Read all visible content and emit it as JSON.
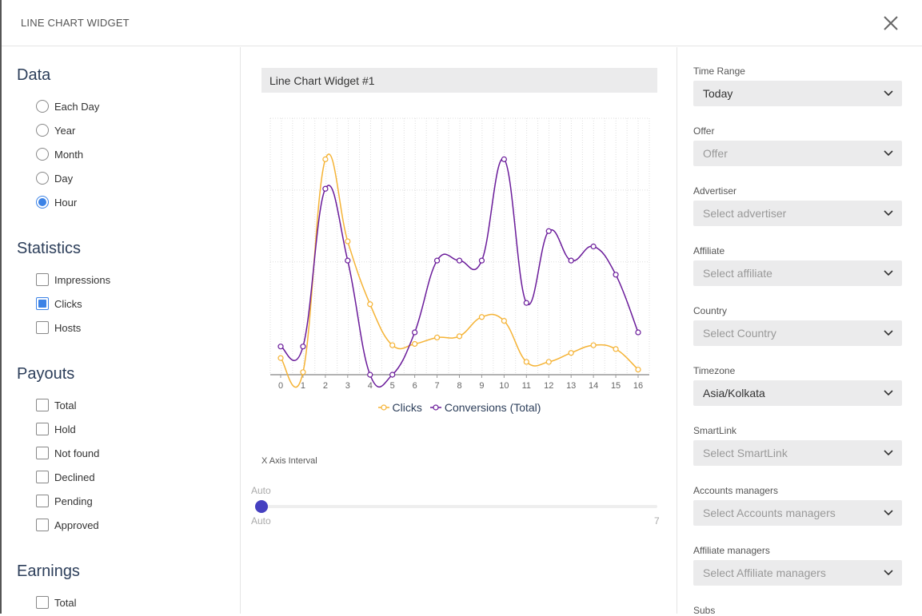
{
  "header": {
    "title": "LINE CHART WIDGET"
  },
  "left": {
    "data_section": {
      "title": "Data",
      "options": [
        {
          "label": "Each Day",
          "selected": false
        },
        {
          "label": "Year",
          "selected": false
        },
        {
          "label": "Month",
          "selected": false
        },
        {
          "label": "Day",
          "selected": false
        },
        {
          "label": "Hour",
          "selected": true
        }
      ]
    },
    "statistics_section": {
      "title": "Statistics",
      "options": [
        {
          "label": "Impressions",
          "checked": false
        },
        {
          "label": "Clicks",
          "checked": true
        },
        {
          "label": "Hosts",
          "checked": false
        }
      ]
    },
    "payouts_section": {
      "title": "Payouts",
      "options": [
        {
          "label": "Total",
          "checked": false
        },
        {
          "label": "Hold",
          "checked": false
        },
        {
          "label": "Not found",
          "checked": false
        },
        {
          "label": "Declined",
          "checked": false
        },
        {
          "label": "Pending",
          "checked": false
        },
        {
          "label": "Approved",
          "checked": false
        }
      ]
    },
    "earnings_section": {
      "title": "Earnings",
      "options": [
        {
          "label": "Total",
          "checked": false
        }
      ]
    }
  },
  "center": {
    "widget_name": "Line Chart Widget #1",
    "slider": {
      "label": "X Axis Interval",
      "current_label": "Auto",
      "min_label": "Auto",
      "max_label": "7",
      "value_fraction": 0
    }
  },
  "right": {
    "fields": [
      {
        "label": "Time Range",
        "value": "Today",
        "filled": true
      },
      {
        "label": "Offer",
        "value": "Offer",
        "filled": false
      },
      {
        "label": "Advertiser",
        "value": "Select advertiser",
        "filled": false
      },
      {
        "label": "Affiliate",
        "value": "Select affiliate",
        "filled": false
      },
      {
        "label": "Country",
        "value": "Select Country",
        "filled": false
      },
      {
        "label": "Timezone",
        "value": "Asia/Kolkata",
        "filled": true
      },
      {
        "label": "SmartLink",
        "value": "Select SmartLink",
        "filled": false
      },
      {
        "label": "Accounts managers",
        "value": "Select Accounts managers",
        "filled": false
      },
      {
        "label": "Affiliate managers",
        "value": "Select Affiliate managers",
        "filled": false
      },
      {
        "label": "Subs",
        "value": "",
        "filled": false
      }
    ]
  },
  "colors": {
    "clicks": "#f5b335",
    "conversions": "#6a1b9a",
    "accent": "#3b82e6",
    "slider": "#4540c0"
  },
  "chart_data": {
    "type": "line",
    "title": "",
    "xlabel": "",
    "ylabel": "",
    "x": [
      0,
      1,
      2,
      3,
      4,
      5,
      6,
      7,
      8,
      9,
      10,
      11,
      12,
      13,
      14,
      15,
      16
    ],
    "ylim": [
      0,
      100
    ],
    "grid": true,
    "legend": "bottom",
    "series": [
      {
        "name": "Clicks",
        "color": "#f5b335",
        "values": [
          6.5,
          1,
          84,
          52,
          27.5,
          11.5,
          12,
          14.5,
          15,
          22.5,
          21,
          5,
          5,
          8.5,
          11.5,
          10,
          2
        ]
      },
      {
        "name": "Conversions (Total)",
        "color": "#6a1b9a",
        "values": [
          11,
          11,
          72.5,
          44.5,
          0,
          0,
          16.5,
          44.5,
          44.5,
          44.5,
          84,
          28,
          56,
          44.5,
          50,
          39,
          16.5
        ]
      }
    ]
  }
}
